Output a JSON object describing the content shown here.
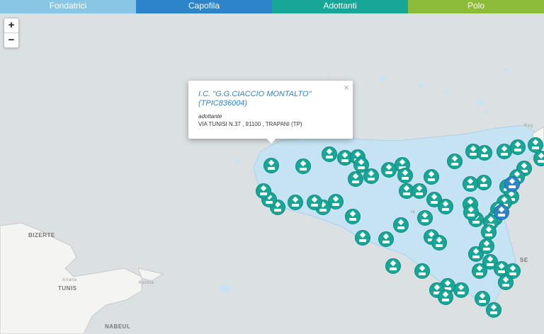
{
  "tabs": [
    {
      "label": "Fondatrici",
      "color": "#88c6e3"
    },
    {
      "label": "Capofila",
      "color": "#2d84c8"
    },
    {
      "label": "Adottanti",
      "color": "#17a697"
    },
    {
      "label": "Polo",
      "color": "#8dbb3a"
    }
  ],
  "zoom": {
    "in": "+",
    "out": "−"
  },
  "places": {
    "bizerte": "BIZERTE",
    "ariana": "Ariana",
    "tunis": "TUNIS",
    "kelibia": "Kelibia",
    "nabeul": "NABEUL",
    "reggio": "Reg",
    "catania": "A",
    "siracusa": "SE",
    "marsala": "ta"
  },
  "popup": {
    "title": "I.C. \"G.G.CIACCIO MONTALTO\" (TPIC836004)",
    "type": "adottante",
    "address": "VIA TUNISI N.37 , 91100 , TRAPANI (TP)",
    "close": "×"
  },
  "colors": {
    "sea": "#dbe0e3",
    "land": "#f3f3f1",
    "sicily": "#c5e3f2",
    "marker": "#17a697"
  },
  "icons": {
    "marker": "school-marker-icon"
  }
}
